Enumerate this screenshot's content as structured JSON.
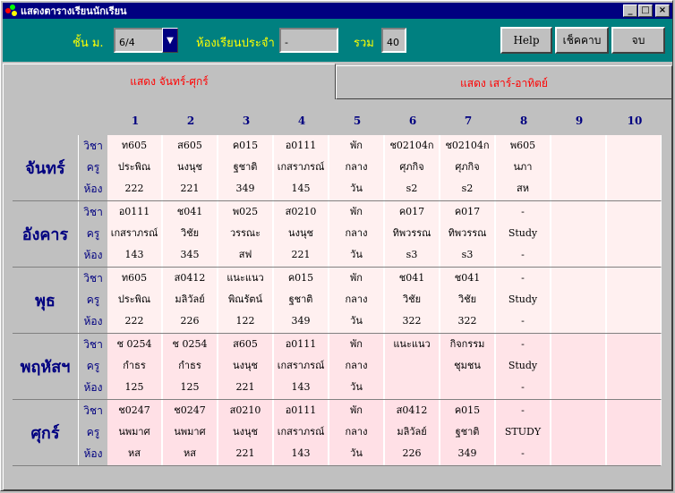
{
  "window": {
    "title": "แสดงตารางเรียนนักเรียน",
    "minimize_icon": "minimize-icon",
    "maximize_icon": "maximize-icon",
    "close_icon": "close-icon"
  },
  "toolbar": {
    "class_label": "ชั้น ม.",
    "class_value": "6/4",
    "homeroom_label": "ห้องเรียนประจำ",
    "homeroom_value": "-",
    "total_label": "รวม",
    "total_value": "40",
    "help_label": "Help",
    "check_period_label": "เช็คคาบ",
    "exit_label": "จบ"
  },
  "tabs": [
    {
      "label": "แสดง จันทร์-ศุกร์",
      "active": true
    },
    {
      "label": "แสดง เสาร์-อาทิตย์",
      "active": false
    }
  ],
  "periods": [
    "1",
    "2",
    "3",
    "4",
    "5",
    "6",
    "7",
    "8",
    "9",
    "10"
  ],
  "row_labels": {
    "subject": "วิชา",
    "teacher": "ครู",
    "room": "ห้อง"
  },
  "days": [
    {
      "name": "จันทร์",
      "cells": [
        [
          "ท605",
          "ประพิณ",
          "222"
        ],
        [
          "ส605",
          "นงนุช",
          "221"
        ],
        [
          "ค015",
          "ฐชาติ",
          "349"
        ],
        [
          "อ0111",
          "เกสราภรณ์",
          "145"
        ],
        [
          "พัก",
          "กลาง",
          "วัน"
        ],
        [
          "ช02104ก",
          "ศุภกิจ",
          "s2"
        ],
        [
          "ช02104ก",
          "ศุภกิจ",
          "s2"
        ],
        [
          "พ605",
          "นภา",
          "สห"
        ],
        [
          "",
          "",
          ""
        ],
        [
          "",
          "",
          ""
        ]
      ]
    },
    {
      "name": "อังคาร",
      "cells": [
        [
          "อ0111",
          "เกสราภรณ์",
          "143"
        ],
        [
          "ช041",
          "วิชัย",
          "345"
        ],
        [
          "พ025",
          "วรรณะ",
          "สฟ"
        ],
        [
          "ส0210",
          "นงนุช",
          "221"
        ],
        [
          "พัก",
          "กลาง",
          "วัน"
        ],
        [
          "ค017",
          "ทิพวรรณ",
          "s3"
        ],
        [
          "ค017",
          "ทิพวรรณ",
          "s3"
        ],
        [
          "-",
          "Study",
          "-"
        ],
        [
          "",
          "",
          ""
        ],
        [
          "",
          "",
          ""
        ]
      ]
    },
    {
      "name": "พุธ",
      "cells": [
        [
          "ท605",
          "ประพิณ",
          "222"
        ],
        [
          "ส0412",
          "มลิวัลย์",
          "226"
        ],
        [
          "แนะแนว",
          "พิณรัตน์",
          "122"
        ],
        [
          "ค015",
          "ฐชาติ",
          "349"
        ],
        [
          "พัก",
          "กลาง",
          "วัน"
        ],
        [
          "ช041",
          "วิชัย",
          "322"
        ],
        [
          "ช041",
          "วิชัย",
          "322"
        ],
        [
          "-",
          "Study",
          "-"
        ],
        [
          "",
          "",
          ""
        ],
        [
          "",
          "",
          ""
        ]
      ]
    },
    {
      "name": "พฤหัสฯ",
      "cells": [
        [
          "ช 0254",
          "กำธร",
          "125"
        ],
        [
          "ช 0254",
          "กำธร",
          "125"
        ],
        [
          "ส605",
          "นงนุช",
          "221"
        ],
        [
          "อ0111",
          "เกสราภรณ์",
          "143"
        ],
        [
          "พัก",
          "กลาง",
          "วัน"
        ],
        [
          "แนะแนว",
          "",
          ""
        ],
        [
          "กิจกรรม",
          "ชุมชน",
          ""
        ],
        [
          "-",
          "Study",
          "-"
        ],
        [
          "",
          "",
          ""
        ],
        [
          "",
          "",
          ""
        ]
      ]
    },
    {
      "name": "ศุกร์",
      "cells": [
        [
          "ช0247",
          "นพมาศ",
          "หส"
        ],
        [
          "ช0247",
          "นพมาศ",
          "หส"
        ],
        [
          "ส0210",
          "นงนุช",
          "221"
        ],
        [
          "อ0111",
          "เกสราภรณ์",
          "143"
        ],
        [
          "พัก",
          "กลาง",
          "วัน"
        ],
        [
          "ส0412",
          "มลิวัลย์",
          "226"
        ],
        [
          "ค015",
          "ฐชาติ",
          "349"
        ],
        [
          "-",
          "STUDY",
          "-"
        ],
        [
          "",
          "",
          ""
        ],
        [
          "",
          "",
          ""
        ]
      ]
    }
  ],
  "colors": {
    "accent": "#008080",
    "title_bg": "#000080",
    "tab_text": "#ff0000",
    "label_blue": "#000080"
  }
}
